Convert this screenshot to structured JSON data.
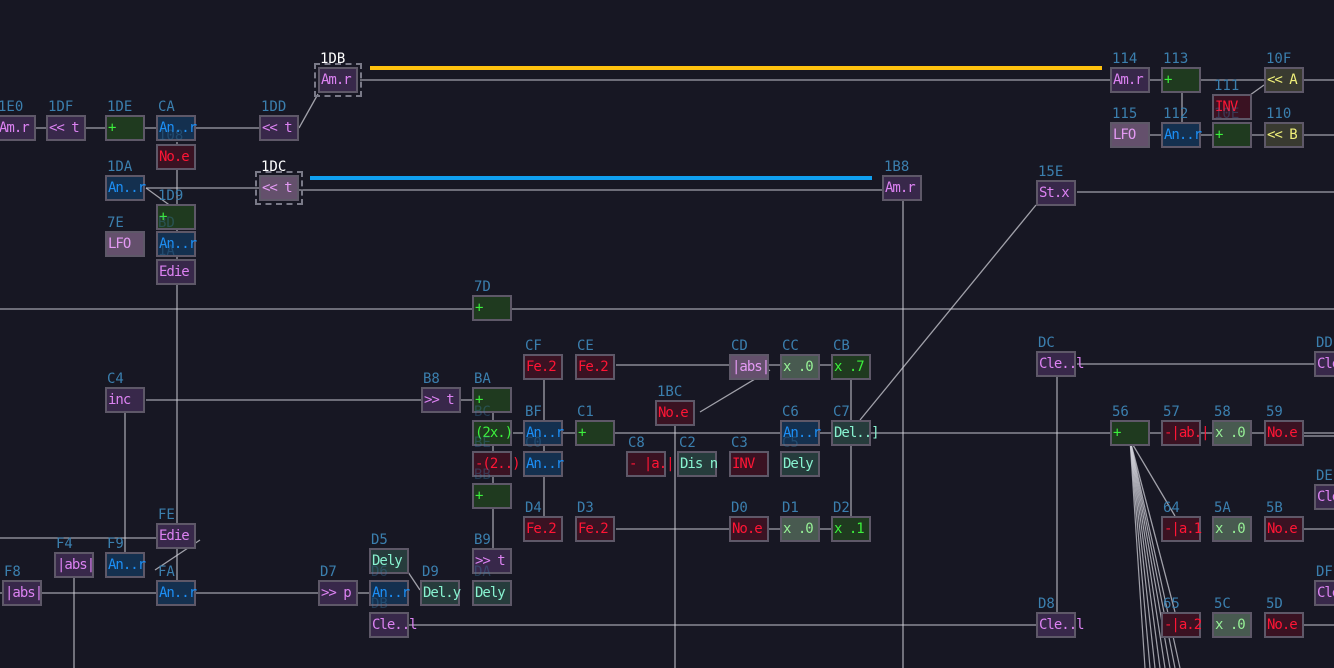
{
  "colors": {
    "background": "#171723",
    "wire": "#d0d0d8",
    "selected_wire_a": "#ffc20e",
    "selected_wire_b": "#10a0f0",
    "node_id": "#3b7fae"
  },
  "nodes": [
    {
      "id": "1E0",
      "label": "Am.r",
      "kind": "purple"
    },
    {
      "id": "1DF",
      "label": "<< t",
      "kind": "purple"
    },
    {
      "id": "1DE",
      "label": "+",
      "kind": "green"
    },
    {
      "id": "CA",
      "label": "An..r",
      "kind": "blue"
    },
    {
      "id": "108",
      "label": "No.e",
      "kind": "red"
    },
    {
      "id": "1DD",
      "label": "<< t",
      "kind": "purple"
    },
    {
      "id": "1DB",
      "label": "Am.r",
      "kind": "purple",
      "selected": true
    },
    {
      "id": "1DC",
      "label": "<< t",
      "kind": "lfo",
      "selected": true
    },
    {
      "id": "1DA",
      "label": "An..r",
      "kind": "blue"
    },
    {
      "id": "1D9",
      "label": "+",
      "kind": "green"
    },
    {
      "id": "7E",
      "label": "LFO",
      "kind": "lfo"
    },
    {
      "id": "BD",
      "label": "An..r",
      "kind": "blue"
    },
    {
      "id": "1A",
      "label": "Edie",
      "kind": "purple"
    },
    {
      "id": "7D",
      "label": "+",
      "kind": "green"
    },
    {
      "id": "114",
      "label": "Am.r",
      "kind": "purple"
    },
    {
      "id": "113",
      "label": "+",
      "kind": "green"
    },
    {
      "id": "10F",
      "label": "<< A",
      "kind": "yellow"
    },
    {
      "id": "111",
      "label": "INV",
      "kind": "red"
    },
    {
      "id": "115",
      "label": "LFO",
      "kind": "lfo"
    },
    {
      "id": "112",
      "label": "An..r",
      "kind": "blue"
    },
    {
      "id": "10E",
      "label": "+",
      "kind": "green"
    },
    {
      "id": "110",
      "label": "<< B",
      "kind": "yellow"
    },
    {
      "id": "15E",
      "label": "St.x",
      "kind": "purple"
    },
    {
      "id": "1B8",
      "label": "Am.r",
      "kind": "purple"
    },
    {
      "id": "C4",
      "label": "inc",
      "kind": "purple"
    },
    {
      "id": "B8",
      "label": ">> t",
      "kind": "purple"
    },
    {
      "id": "BA",
      "label": "+",
      "kind": "green"
    },
    {
      "id": "BC",
      "label": "(2x.)",
      "kind": "green"
    },
    {
      "id": "BE",
      "label": "-(2..)",
      "kind": "red"
    },
    {
      "id": "BB",
      "label": "+",
      "kind": "green"
    },
    {
      "id": "CF",
      "label": "Fe.2",
      "kind": "red"
    },
    {
      "id": "CE",
      "label": "Fe.2",
      "kind": "red"
    },
    {
      "id": "CD",
      "label": "|abs|",
      "kind": "lfo"
    },
    {
      "id": "CC",
      "label": "x .0",
      "kind": "gray"
    },
    {
      "id": "CB",
      "label": "x .7",
      "kind": "green"
    },
    {
      "id": "1BC",
      "label": "No.e",
      "kind": "red"
    },
    {
      "id": "BF",
      "label": "An..r",
      "kind": "blue"
    },
    {
      "id": "C0",
      "label": "An..r",
      "kind": "blue"
    },
    {
      "id": "C1",
      "label": "+",
      "kind": "green"
    },
    {
      "id": "C8",
      "label": "- |a.|",
      "kind": "red"
    },
    {
      "id": "C2",
      "label": "Dis n",
      "kind": "teal"
    },
    {
      "id": "C3",
      "label": "INV",
      "kind": "red"
    },
    {
      "id": "C6",
      "label": "An..r",
      "kind": "blue"
    },
    {
      "id": "C5",
      "label": "Dely",
      "kind": "teal"
    },
    {
      "id": "C7",
      "label": "Del..]",
      "kind": "teal"
    },
    {
      "id": "D4",
      "label": "Fe.2",
      "kind": "red"
    },
    {
      "id": "D3",
      "label": "Fe.2",
      "kind": "red"
    },
    {
      "id": "D0",
      "label": "No.e",
      "kind": "red"
    },
    {
      "id": "D1",
      "label": "x .0",
      "kind": "gray"
    },
    {
      "id": "D2",
      "label": "x .1",
      "kind": "green"
    },
    {
      "id": "FE",
      "label": "Edie",
      "kind": "purple"
    },
    {
      "id": "F4",
      "label": "|abs|",
      "kind": "purple"
    },
    {
      "id": "F9",
      "label": "An..r",
      "kind": "blue"
    },
    {
      "id": "F8",
      "label": "|abs|",
      "kind": "purple"
    },
    {
      "id": "FA",
      "label": "An..r",
      "kind": "blue"
    },
    {
      "id": "D7",
      "label": ">> p",
      "kind": "purple"
    },
    {
      "id": "D5",
      "label": "Dely",
      "kind": "teal"
    },
    {
      "id": "D6",
      "label": "An..r",
      "kind": "blue"
    },
    {
      "id": "DB",
      "label": "Cle..l",
      "kind": "purple"
    },
    {
      "id": "D9",
      "label": "Del.y",
      "kind": "teal"
    },
    {
      "id": "B9",
      "label": ">> t",
      "kind": "purple"
    },
    {
      "id": "DA",
      "label": "Dely",
      "kind": "teal"
    },
    {
      "id": "DC",
      "label": "Cle..l",
      "kind": "purple"
    },
    {
      "id": "DD",
      "label": "Cle",
      "kind": "purple"
    },
    {
      "id": "56",
      "label": "+",
      "kind": "green"
    },
    {
      "id": "57",
      "label": "-|ab.|",
      "kind": "red"
    },
    {
      "id": "58",
      "label": "x .0",
      "kind": "gray"
    },
    {
      "id": "59",
      "label": "No.e",
      "kind": "red"
    },
    {
      "id": "DE",
      "label": "Cle",
      "kind": "purple"
    },
    {
      "id": "64",
      "label": "-|a.1",
      "kind": "red"
    },
    {
      "id": "5A",
      "label": "x .0",
      "kind": "gray"
    },
    {
      "id": "5B",
      "label": "No.e",
      "kind": "red"
    },
    {
      "id": "DF",
      "label": "Cle",
      "kind": "purple"
    },
    {
      "id": "D8",
      "label": "Cle..l",
      "kind": "purple"
    },
    {
      "id": "65",
      "label": "-|a.2",
      "kind": "red"
    },
    {
      "id": "5C",
      "label": "x .0",
      "kind": "gray"
    },
    {
      "id": "5D",
      "label": "No.e",
      "kind": "red"
    }
  ]
}
